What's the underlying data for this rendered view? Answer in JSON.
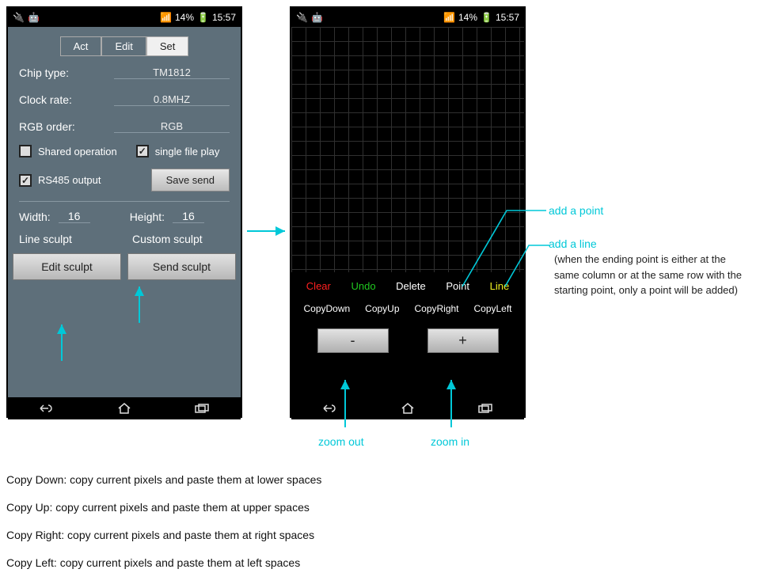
{
  "statusbar": {
    "battery": "14%",
    "time": "15:57"
  },
  "left": {
    "tabs": {
      "act": "Act",
      "edit": "Edit",
      "set": "Set"
    },
    "chip_label": "Chip type:",
    "chip_value": "TM1812",
    "clock_label": "Clock rate:",
    "clock_value": "0.8MHZ",
    "rgb_label": "RGB order:",
    "rgb_value": "RGB",
    "shared": "Shared operation",
    "single": "single file play",
    "rs485": "RS485 output",
    "save": "Save send",
    "width_label": "Width:",
    "width_value": "16",
    "height_label": "Height:",
    "height_value": "16",
    "line_sculpt": "Line sculpt",
    "custom_sculpt": "Custom sculpt",
    "edit_sculpt": "Edit sculpt",
    "send_sculpt": "Send sculpt"
  },
  "right": {
    "clear": "Clear",
    "undo": "Undo",
    "delete": "Delete",
    "point": "Point",
    "line": "Line",
    "copy_down": "CopyDown",
    "copy_up": "CopyUp",
    "copy_right": "CopyRight",
    "copy_left": "CopyLeft",
    "minus": "-",
    "plus": "+"
  },
  "annotations": {
    "add_point": "add a point",
    "add_line": "add a line",
    "zoom_out": "zoom out",
    "zoom_in": "zoom in",
    "note": "(when the ending point is either at the same column or at the same row with the starting point, only a point will be added)"
  },
  "descriptions": {
    "d1": "Copy Down: copy current pixels and paste them at lower spaces",
    "d2": "Copy Up: copy current pixels and paste them at upper spaces",
    "d3": "Copy Right: copy current pixels and paste them at right spaces",
    "d4": "Copy Left: copy current pixels and paste them at left spaces"
  }
}
